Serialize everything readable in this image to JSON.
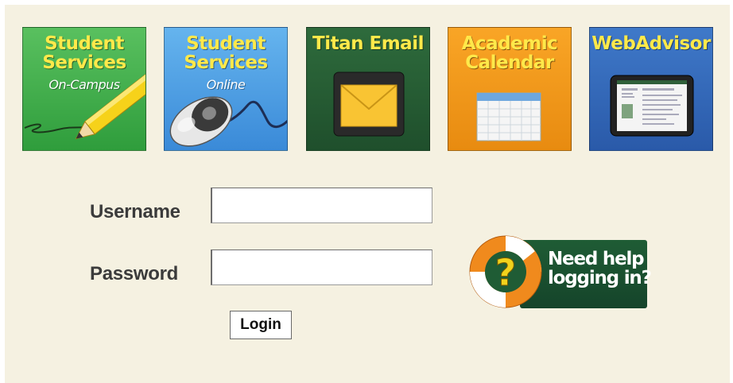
{
  "tiles": [
    {
      "title": "Student Services",
      "subtitle": "On-Campus",
      "icon": "pencil-icon"
    },
    {
      "title": "Student Services",
      "subtitle": "Online",
      "icon": "mouse-icon"
    },
    {
      "title": "Titan Email",
      "subtitle": "",
      "icon": "envelope-icon"
    },
    {
      "title": "Academic Calendar",
      "subtitle": "",
      "icon": "calendar-icon"
    },
    {
      "title": "WebAdvisor",
      "subtitle": "",
      "icon": "tablet-icon"
    }
  ],
  "login": {
    "username_label": "Username",
    "username_value": "",
    "password_label": "Password",
    "password_value": "",
    "button_label": "Login"
  },
  "help": {
    "text": "Need help logging in?",
    "icon": "life-preserver-icon"
  },
  "colors": {
    "background": "#f5f1e1",
    "tile_title": "#ffe94a",
    "help_banner": "#1f5c35",
    "buoy_orange": "#f08a1d",
    "question_mark": "#f2d21c"
  }
}
